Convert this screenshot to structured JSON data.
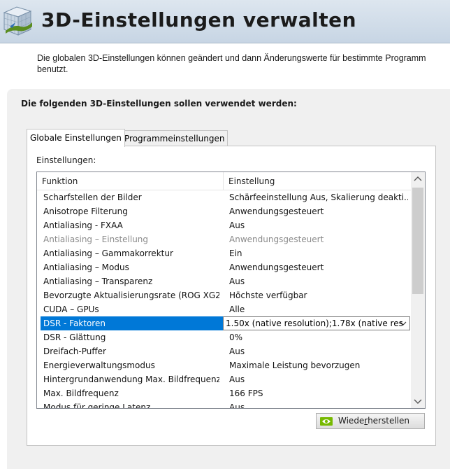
{
  "header": {
    "title": "3D-Einstellungen verwalten",
    "icon": "nvidia-3d-cube-icon"
  },
  "description": {
    "line1": "Die globalen 3D-Einstellungen können geändert und dann Änderungswerte für bestimmte Programm",
    "line2": "benutzt."
  },
  "panel": {
    "heading": "Die folgenden 3D-Einstellungen sollen verwendet werden:"
  },
  "tabs": [
    {
      "label": "Globale Einstellungen",
      "active": true
    },
    {
      "label": "Programmeinstellungen",
      "active": false
    }
  ],
  "settings": {
    "label": "Einstellungen:",
    "columns": {
      "function": "Funktion",
      "setting": "Einstellung"
    },
    "rows": [
      {
        "function": "Scharfstellen der Bilder",
        "setting": "Schärfeeinstellung Aus, Skalierung deakti..."
      },
      {
        "function": "Anisotrope Filterung",
        "setting": "Anwendungsgesteuert"
      },
      {
        "function": "Antialiasing - FXAA",
        "setting": "Aus"
      },
      {
        "function": "Antialiasing – Einstellung",
        "setting": "Anwendungsgesteuert",
        "disabled": true
      },
      {
        "function": "Antialiasing – Gammakorrektur",
        "setting": "Ein"
      },
      {
        "function": "Antialiasing – Modus",
        "setting": "Anwendungsgesteuert"
      },
      {
        "function": "Antialiasing – Transparenz",
        "setting": "Aus"
      },
      {
        "function": "Bevorzugte Aktualisierungsrate (ROG XG2...",
        "setting": "Höchste verfügbar"
      },
      {
        "function": "CUDA – GPUs",
        "setting": "Alle"
      },
      {
        "function": "DSR - Faktoren",
        "setting": "1.50x (native resolution);1.78x (native res",
        "selected": true
      },
      {
        "function": "DSR - Glättung",
        "setting": "0%"
      },
      {
        "function": "Dreifach-Puffer",
        "setting": "Aus"
      },
      {
        "function": "Energieverwaltungsmodus",
        "setting": "Maximale Leistung bevorzugen"
      },
      {
        "function": "Hintergrundanwendung Max. Bildfrequenz",
        "setting": "Aus"
      },
      {
        "function": "Max. Bildfrequenz",
        "setting": "166 FPS"
      },
      {
        "function": "Modus für geringe Latenz",
        "setting": "Aus"
      }
    ]
  },
  "restore_button": {
    "label_pre": "Wiede",
    "label_accel": "r",
    "label_post": "herstellen",
    "icon": "nvidia-logo-icon"
  },
  "colors": {
    "header_bg": "#c7d5e4",
    "selection": "#0078d7",
    "panel_bg": "#f0f0f0",
    "nvidia_green": "#76b900"
  }
}
